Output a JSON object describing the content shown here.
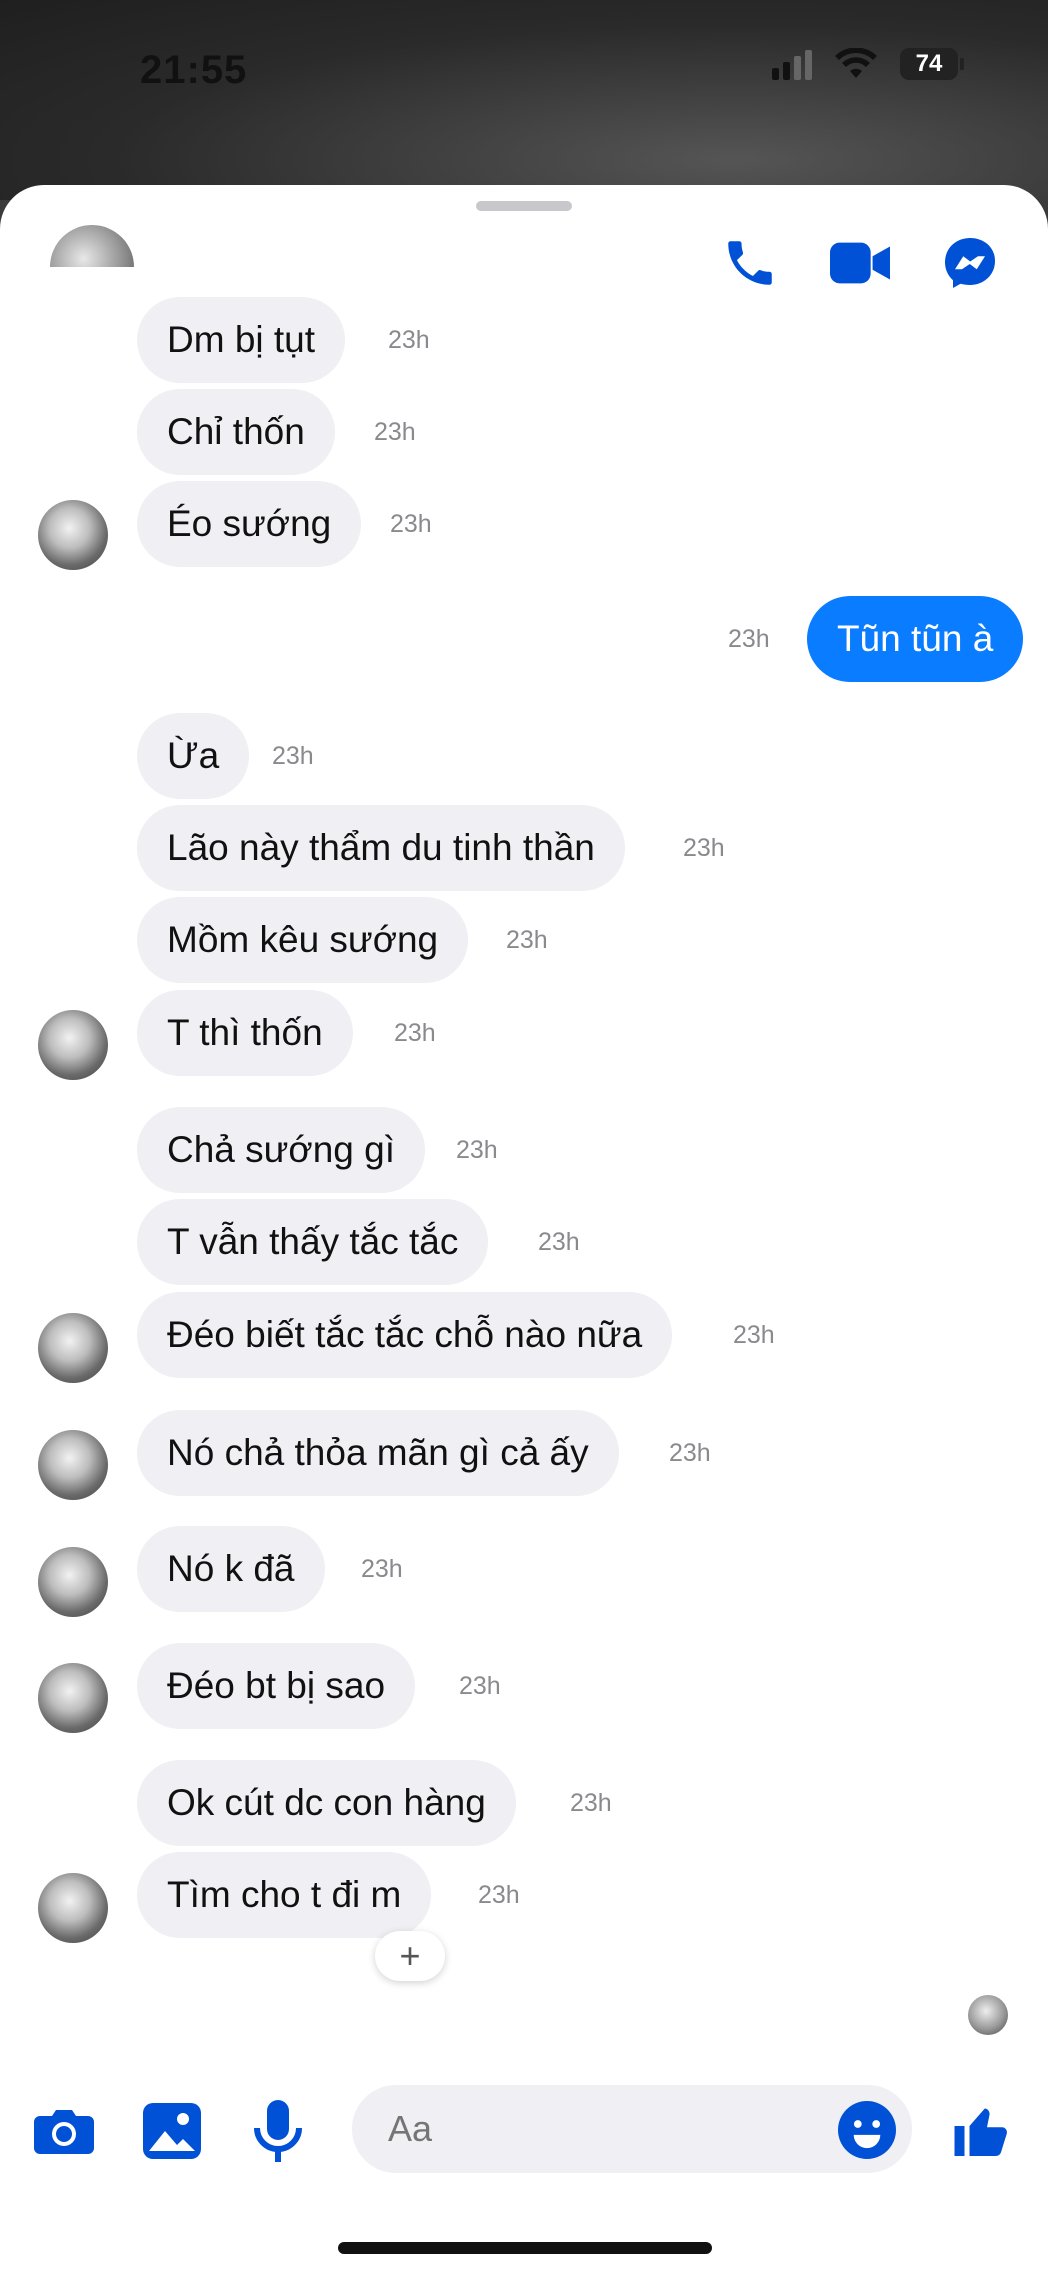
{
  "status_bar": {
    "time": "21:55",
    "battery": "74"
  },
  "composer": {
    "placeholder": "Aa"
  },
  "messages": [
    {
      "text": "Dm bị tụt",
      "time": "23h"
    },
    {
      "text": "Chỉ thốn",
      "time": "23h"
    },
    {
      "text": "Éo sướng",
      "time": "23h"
    },
    {
      "text": "Tũn tũn à",
      "time": "23h"
    },
    {
      "text": "Ừa",
      "time": "23h"
    },
    {
      "text": "Lão này thẩm du tinh thần",
      "time": "23h"
    },
    {
      "text": "Mồm kêu sướng",
      "time": "23h"
    },
    {
      "text": "T thì thốn",
      "time": "23h"
    },
    {
      "text": "Chả sướng gì",
      "time": "23h"
    },
    {
      "text": "T vẫn thấy tắc tắc",
      "time": "23h"
    },
    {
      "text": "Đéo biết tắc tắc chỗ nào nữa",
      "time": "23h"
    },
    {
      "text": "Nó chả thỏa mãn gì cả ấy",
      "time": "23h"
    },
    {
      "text": "Nó k đã",
      "time": "23h"
    },
    {
      "text": "Đéo bt bị sao",
      "time": "23h"
    },
    {
      "text": "Ok cút dc con hàng",
      "time": "23h"
    },
    {
      "text": "Tìm cho t đi m",
      "time": "23h"
    }
  ],
  "reaction_button": "+",
  "colors": {
    "accent": "#0a7cff",
    "icon_blue": "#0051d6",
    "bubble_in": "#efeff4"
  },
  "icons": [
    "phone-icon",
    "video-icon",
    "messenger-icon",
    "camera-icon",
    "gallery-icon",
    "microphone-icon",
    "emoji-icon",
    "thumbs-up-icon"
  ]
}
